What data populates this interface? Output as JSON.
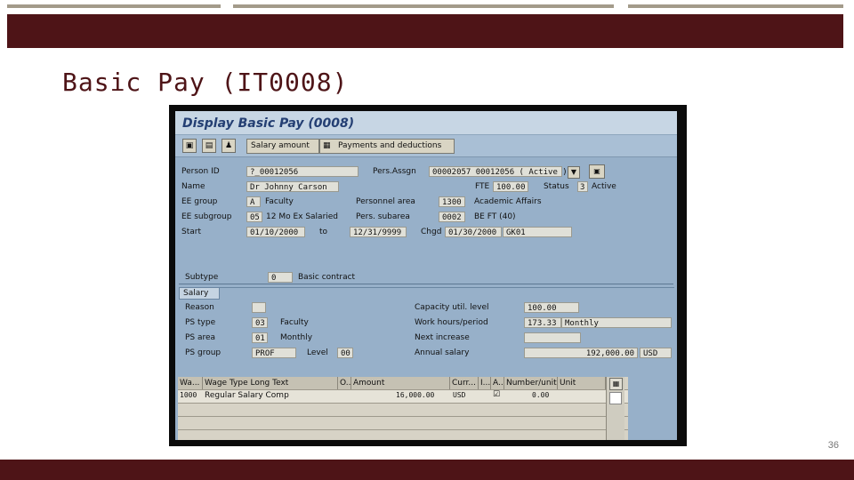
{
  "slide": {
    "title": "Basic Pay (IT0008)",
    "page_number": "36"
  },
  "window": {
    "title": "Display Basic Pay (0008)"
  },
  "toolbar": {
    "salary_amount": "Salary amount",
    "payments": "Payments and deductions"
  },
  "header": {
    "person_id_label": "Person ID",
    "person_id": "?_00012056",
    "pers_assgn_label": "Pers.Assgn",
    "pers_assgn": "00002057 00012056 ( Active )",
    "name_label": "Name",
    "name": "Dr  Johnny  Carson",
    "fte_label": "FTE",
    "fte": "100.00",
    "status_label": "Status",
    "status_code": "3",
    "status_text": "Active",
    "ee_group_label": "EE group",
    "ee_group_code": "A",
    "ee_group_text": "Faculty",
    "personnel_area_label": "Personnel area",
    "personnel_area_code": "1300",
    "personnel_area_text": "Academic Affairs",
    "ee_subgroup_label": "EE subgroup",
    "ee_subgroup_code": "05",
    "ee_subgroup_text": "12 Mo Ex Salaried",
    "pers_subarea_label": "Pers. subarea",
    "pers_subarea_code": "0002",
    "pers_subarea_text": "BE FT (40)",
    "start_label": "Start",
    "start": "01/10/2000",
    "to_label": "to",
    "to": "12/31/9999",
    "chgd_label": "Chgd",
    "chgd": "01/30/2000",
    "chgd_user": "GK01"
  },
  "subtype": {
    "label": "Subtype",
    "code": "0",
    "text": "Basic contract"
  },
  "salary": {
    "tab": "Salary",
    "reason_label": "Reason",
    "ps_type_label": "PS type",
    "ps_type_code": "03",
    "ps_type_text": "Faculty",
    "ps_area_label": "PS area",
    "ps_area_code": "01",
    "ps_area_text": "Monthly",
    "ps_group_label": "PS group",
    "ps_group": "PROF",
    "level_label": "Level",
    "level": "00",
    "capacity_label": "Capacity util. level",
    "capacity": "100.00",
    "work_hours_label": "Work hours/period",
    "work_hours": "173.33",
    "work_hours_period": "Monthly",
    "next_increase_label": "Next increase",
    "annual_salary_label": "Annual salary",
    "annual_salary": "192,000.00",
    "annual_currency": "USD"
  },
  "table": {
    "headers": [
      "Wa...",
      "Wage Type Long Text",
      "O...",
      "Amount",
      "Curr...",
      "I...",
      "A...",
      "Number/unit",
      "Unit"
    ],
    "row": {
      "wage_type": "1000",
      "long_text": "Regular Salary Comp",
      "amount": "16,000.00",
      "currency": "USD",
      "number": "0.00"
    }
  }
}
